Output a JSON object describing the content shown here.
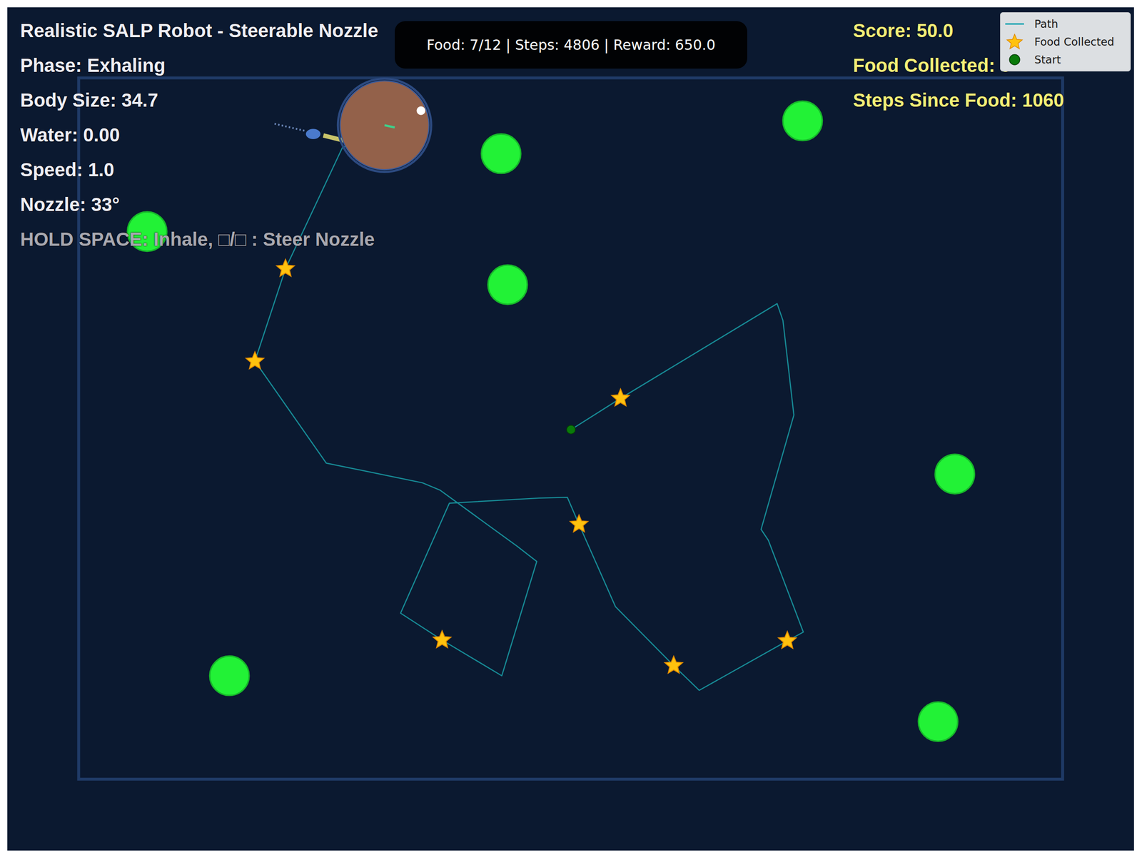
{
  "hud_left": [
    {
      "text": "Realistic SALP Robot - Steerable Nozzle",
      "kind": "title"
    },
    {
      "text": "Phase: Exhaling",
      "kind": "stat"
    },
    {
      "text": "Body Size: 34.7",
      "kind": "stat"
    },
    {
      "text": "Water: 0.00",
      "kind": "stat"
    },
    {
      "text": "Speed: 1.0",
      "kind": "stat"
    },
    {
      "text": "Nozzle: 33°",
      "kind": "stat"
    },
    {
      "text": "HOLD SPACE: Inhale, □/□ : Steer Nozzle",
      "kind": "hint"
    }
  ],
  "hud_right": [
    "Score: 50.0",
    "Food Collected: 5",
    "Steps Since Food: 1060"
  ],
  "banner": "Food: 7/12 | Steps: 4806 | Reward: 650.0",
  "legend": [
    {
      "label": "Path",
      "kind": "line",
      "color": "#17a3b0"
    },
    {
      "label": "Food Collected",
      "kind": "star",
      "color": "#ffc20e"
    },
    {
      "label": "Start",
      "kind": "dot",
      "color": "#0a7a0a"
    }
  ]
}
